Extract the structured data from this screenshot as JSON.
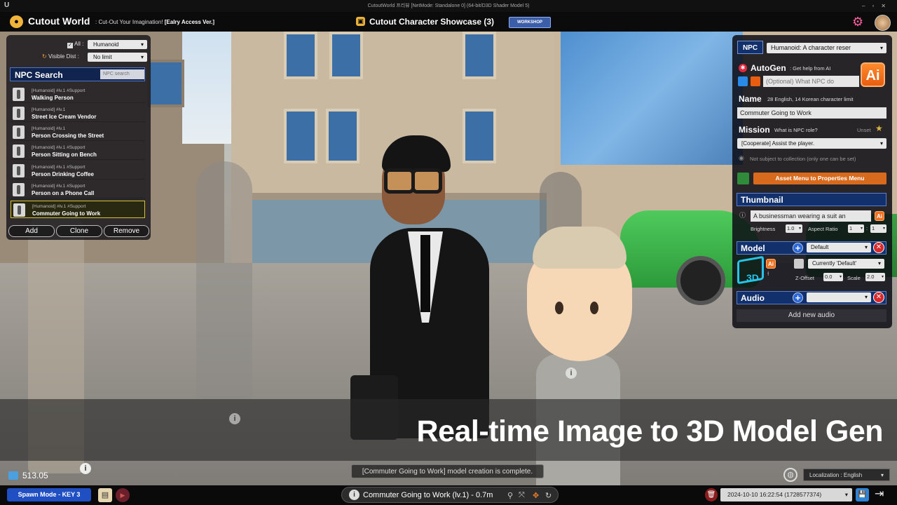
{
  "window": {
    "title": "CutoutWorld 프리뷰 [NetMode: Standalone 0]  (64-bit/D3D Shader Model 5)",
    "engine_logo": "U",
    "controls": "–▫✕"
  },
  "app": {
    "name": "Cutout World",
    "tagline": "Cut-Out Your Imagination!",
    "version": "[Ealry Access Ver.]",
    "showcase_title": "Cutout Character Showcase (3)",
    "workshop_label": "WORKSHOP",
    "settings_icon": "gear-icon",
    "colors": {
      "accent": "#1f4fc2",
      "ai_orange": "#f07020",
      "danger": "#d82a2a",
      "settings": "#ff5fa0"
    }
  },
  "left_panel": {
    "all_label": "All",
    "all_checked": true,
    "type_filter": "Humanoid",
    "visible_dist_label": "Visible Dist",
    "visible_dist_value": "No limit",
    "search_title": "NPC Search",
    "search_placeholder": "NPC search",
    "items": [
      {
        "tags": "[Humanoid] #lv.1 #Support",
        "name": "Walking Person",
        "selected": false
      },
      {
        "tags": "[Humanoid] #lv.1",
        "name": "Street Ice Cream Vendor",
        "selected": false
      },
      {
        "tags": "[Humanoid] #lv.1",
        "name": "Person Crossing the Street",
        "selected": false
      },
      {
        "tags": "[Humanoid] #lv.1 #Support",
        "name": "Person Sitting on Bench",
        "selected": false
      },
      {
        "tags": "[Humanoid] #lv.1 #Support",
        "name": "Person Drinking Coffee",
        "selected": false
      },
      {
        "tags": "[Humanoid] #lv.1 #Support",
        "name": "Person on a Phone Call",
        "selected": false
      },
      {
        "tags": "[Humanoid] #lv.1 #Support",
        "name": "Commuter Going to Work",
        "selected": true
      }
    ],
    "add_label": "Add",
    "clone_label": "Clone",
    "remove_label": "Remove"
  },
  "right_panel": {
    "npc_badge": "NPC",
    "type_select": "Humanoid: A character reser",
    "autogen_title": "AutoGen",
    "autogen_hint": ": Get help from AI",
    "autogen_placeholder": "(Optional) What NPC do",
    "ai_label": "Ai",
    "name_title": "Name",
    "name_hint": "28 English, 14 Korean character limit",
    "name_value": "Commuter Going to Work",
    "mission_title": "Mission",
    "mission_hint": "What is NPC role?",
    "unset_label": "Unset",
    "mission_value": "[Cooperate] Assist the player.",
    "collection_note": "Not subject to collection (only one can be set)",
    "asset_menu_label": "Asset Menu to Properties Menu",
    "thumbnail_title": "Thumbnail",
    "thumbnail_prompt": "A businessman wearing a suit an",
    "brightness_label": "Brightness",
    "brightness_value": "1.0",
    "aspect_label": "Aspect Ratio",
    "aspect_w": "1",
    "aspect_sep": ":",
    "aspect_h": "1",
    "model_title": "Model",
    "model_value": "Default",
    "model_current": "Currently 'Default'",
    "zoffset_label": "Z-Offset",
    "zoffset_value": "0.0",
    "scale_label": "Scale",
    "scale_value": "2.0",
    "model_3d_label": "3D",
    "audio_title": "Audio",
    "audio_value": "",
    "add_audio_label": "Add new audio"
  },
  "overlay": {
    "banner": "Real-time Image to 3D Model Gen",
    "toast": "[Commuter Going to Work] model creation is complete.",
    "fps": "513.05",
    "localization": "Localization : English"
  },
  "bottom_bar": {
    "spawn_mode": "Spawn Mode - KEY 3",
    "status": "Commuter Going to Work (lv.1) - 0.7m",
    "datetime": "2024-10-10 16:22:54 (1728577374)"
  }
}
